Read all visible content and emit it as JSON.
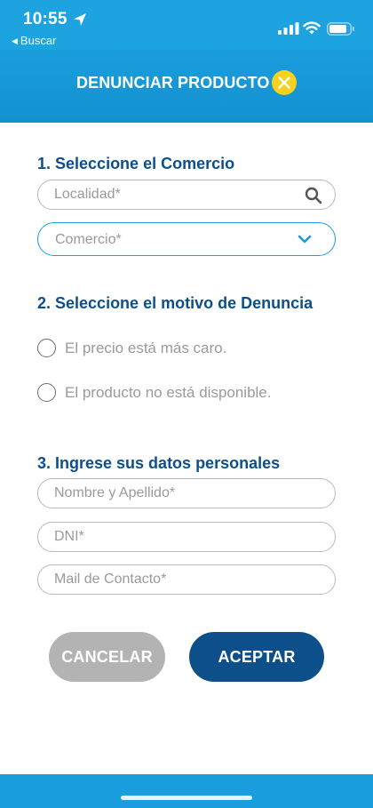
{
  "status_bar": {
    "time": "10:55",
    "back_app": "Buscar",
    "icons": [
      "location-arrow-icon",
      "cellular-signal-icon",
      "wifi-icon",
      "battery-icon"
    ]
  },
  "header": {
    "title": "DENUNCIAR PRODUCTO",
    "close_icon": "close-icon"
  },
  "section1": {
    "title": "1. Seleccione el Comercio",
    "localidad_placeholder": "Localidad*",
    "comercio_label": "Comercio*"
  },
  "section2": {
    "title": "2. Seleccione el motivo de Denuncia",
    "options": [
      {
        "label": "El precio está más caro.",
        "selected": false
      },
      {
        "label": "El producto no está disponible.",
        "selected": false
      }
    ]
  },
  "section3": {
    "title": "3. Ingrese sus datos personales",
    "nombre_placeholder": "Nombre y Apellido*",
    "dni_placeholder": "DNI*",
    "mail_placeholder": "Mail de Contacto*"
  },
  "actions": {
    "cancel_label": "CANCELAR",
    "accept_label": "ACEPTAR"
  },
  "colors": {
    "brand_blue": "#1a9ddc",
    "dark_blue": "#0d4f8b",
    "close_yellow": "#f7d21c",
    "cancel_gray": "#b3b3b3"
  }
}
